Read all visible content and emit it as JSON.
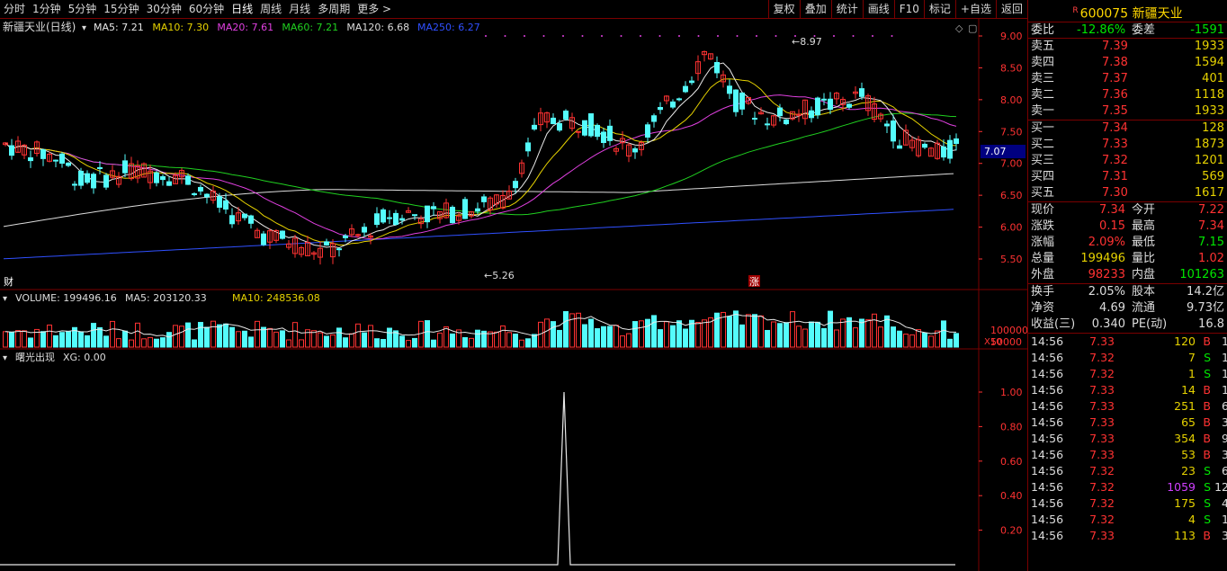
{
  "toolbar": {
    "periods": [
      "分时",
      "1分钟",
      "5分钟",
      "15分钟",
      "30分钟",
      "60分钟",
      "日线",
      "周线",
      "月线",
      "多周期",
      "更多 >"
    ],
    "active_period": "日线",
    "buttons": [
      "复权",
      "叠加",
      "统计",
      "画线",
      "F10",
      "标记",
      "+自选",
      "返回"
    ]
  },
  "main_chart": {
    "title": "新疆天业(日线)",
    "ma": [
      {
        "label": "MA5: 7.21",
        "color": "#e8e8e8"
      },
      {
        "label": "MA10: 7.30",
        "color": "#e6d200"
      },
      {
        "label": "MA20: 7.61",
        "color": "#e040e0"
      },
      {
        "label": "MA60: 7.21",
        "color": "#20d020"
      },
      {
        "label": "MA120: 6.68",
        "color": "#dcdcdc"
      },
      {
        "label": "MA250: 6.27",
        "color": "#3050ff"
      }
    ],
    "price_axis": [
      "9.00",
      "8.50",
      "8.00",
      "7.50",
      "7.00",
      "6.50",
      "6.00",
      "5.50"
    ],
    "current_price_tag": "7.07",
    "high_label": "8.97",
    "low_label": "5.26",
    "marker_cai": "财",
    "marker_zhang": "涨"
  },
  "volume_chart": {
    "title": "VOLUME: 199496.16",
    "ma5": "MA5: 203120.33",
    "ma10": "MA10: 248536.08",
    "axis": [
      "100000",
      "50000"
    ],
    "unit": "X10"
  },
  "indicator_chart": {
    "title": "曙光出现",
    "value": "XG: 0.00",
    "axis": [
      "1.00",
      "0.80",
      "0.60",
      "0.40",
      "0.20"
    ]
  },
  "quote": {
    "code": "600075",
    "name": "新疆天业",
    "weibi_label": "委比",
    "weibi": "-12.86%",
    "weicha_label": "委差",
    "weicha": "-1591",
    "sells": [
      {
        "label": "卖五",
        "price": "7.39",
        "vol": "1933"
      },
      {
        "label": "卖四",
        "price": "7.38",
        "vol": "1594"
      },
      {
        "label": "卖三",
        "price": "7.37",
        "vol": "401"
      },
      {
        "label": "卖二",
        "price": "7.36",
        "vol": "1118"
      },
      {
        "label": "卖一",
        "price": "7.35",
        "vol": "1933"
      }
    ],
    "buys": [
      {
        "label": "买一",
        "price": "7.34",
        "vol": "128"
      },
      {
        "label": "买二",
        "price": "7.33",
        "vol": "1873"
      },
      {
        "label": "买三",
        "price": "7.32",
        "vol": "1201"
      },
      {
        "label": "买四",
        "price": "7.31",
        "vol": "569"
      },
      {
        "label": "买五",
        "price": "7.30",
        "vol": "1617"
      }
    ],
    "stats1": [
      {
        "l1": "现价",
        "v1": "7.34",
        "c1": "c-red",
        "l2": "今开",
        "v2": "7.22",
        "c2": "c-red"
      },
      {
        "l1": "涨跌",
        "v1": "0.15",
        "c1": "c-red",
        "l2": "最高",
        "v2": "7.34",
        "c2": "c-red"
      },
      {
        "l1": "涨幅",
        "v1": "2.09%",
        "c1": "c-red",
        "l2": "最低",
        "v2": "7.15",
        "c2": "c-green"
      },
      {
        "l1": "总量",
        "v1": "199496",
        "c1": "c-yellow",
        "l2": "量比",
        "v2": "1.02",
        "c2": "c-red"
      },
      {
        "l1": "外盘",
        "v1": "98233",
        "c1": "c-red",
        "l2": "内盘",
        "v2": "101263",
        "c2": "c-green"
      }
    ],
    "stats2": [
      {
        "l1": "换手",
        "v1": "2.05%",
        "l2": "股本",
        "v2": "14.2亿"
      },
      {
        "l1": "净资",
        "v1": "4.69",
        "l2": "流通",
        "v2": "9.73亿"
      },
      {
        "l1": "收益(三)",
        "v1": "0.340",
        "l2": "PE(动)",
        "v2": "16.8"
      }
    ],
    "trades": [
      {
        "time": "14:56",
        "price": "7.33",
        "vol": "120",
        "side": "B",
        "n": "1"
      },
      {
        "time": "14:56",
        "price": "7.32",
        "vol": "7",
        "side": "S",
        "n": "1"
      },
      {
        "time": "14:56",
        "price": "7.32",
        "vol": "1",
        "side": "S",
        "n": "1"
      },
      {
        "time": "14:56",
        "price": "7.33",
        "vol": "14",
        "side": "B",
        "n": "1"
      },
      {
        "time": "14:56",
        "price": "7.33",
        "vol": "251",
        "side": "B",
        "n": "6"
      },
      {
        "time": "14:56",
        "price": "7.33",
        "vol": "65",
        "side": "B",
        "n": "3"
      },
      {
        "time": "14:56",
        "price": "7.33",
        "vol": "354",
        "side": "B",
        "n": "9"
      },
      {
        "time": "14:56",
        "price": "7.33",
        "vol": "53",
        "side": "B",
        "n": "3"
      },
      {
        "time": "14:56",
        "price": "7.32",
        "vol": "23",
        "side": "S",
        "n": "6"
      },
      {
        "time": "14:56",
        "price": "7.32",
        "vol": "1059",
        "side": "S",
        "n": "12"
      },
      {
        "time": "14:56",
        "price": "7.32",
        "vol": "175",
        "side": "S",
        "n": "4"
      },
      {
        "time": "14:56",
        "price": "7.32",
        "vol": "4",
        "side": "S",
        "n": "1"
      },
      {
        "time": "14:56",
        "price": "7.33",
        "vol": "113",
        "side": "B",
        "n": "3"
      }
    ]
  }
}
